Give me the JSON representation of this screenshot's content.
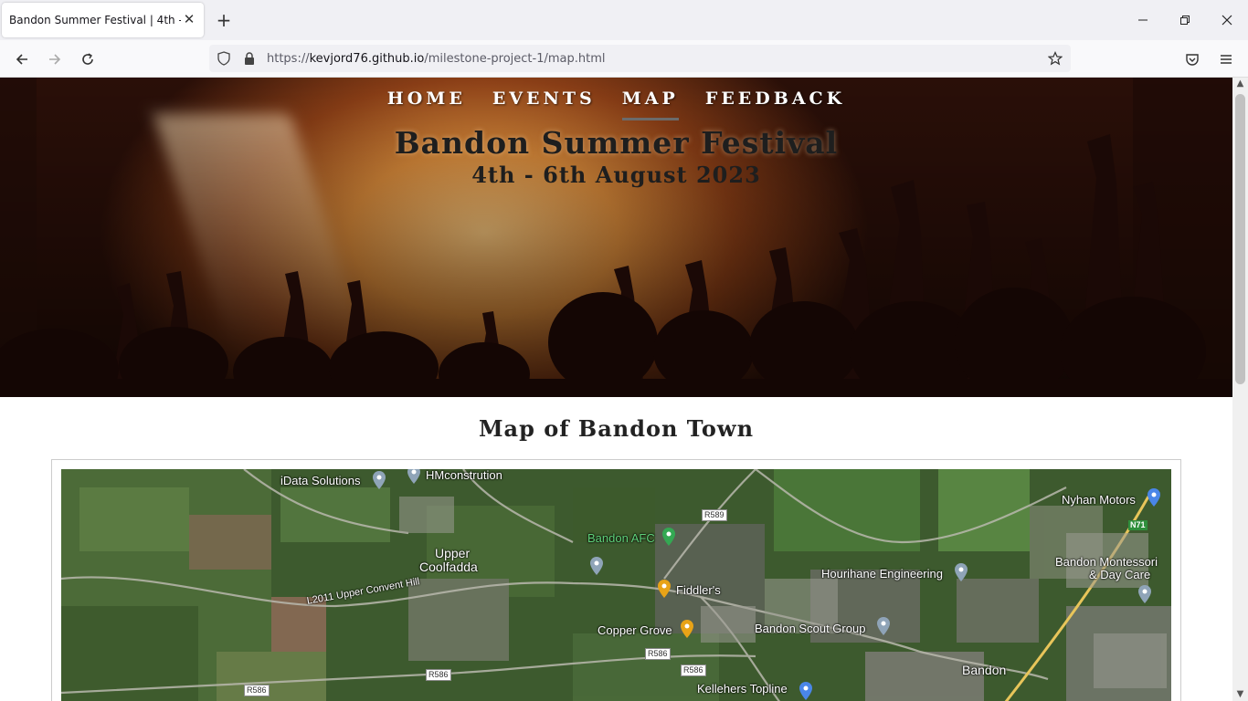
{
  "browser": {
    "tab_title": "Bandon Summer Festival | 4th - 6th August 2023",
    "url_scheme": "https://",
    "url_host": "kevjord76.github.io",
    "url_path": "/milestone-project-1/map.html"
  },
  "nav": {
    "items": [
      {
        "label": "HOME",
        "active": false
      },
      {
        "label": "EVENTS",
        "active": false
      },
      {
        "label": "MAP",
        "active": true
      },
      {
        "label": "FEEDBACK",
        "active": false
      }
    ]
  },
  "hero": {
    "title": "Bandon Summer Festival",
    "subtitle": "4th - 6th August 2023"
  },
  "main": {
    "section_title": "Map of Bandon Town"
  },
  "map": {
    "places": {
      "idata": "iData Solutions",
      "hmconstrution": "HMconstrution",
      "upper": "Upper",
      "coolfadda": "Coolfadda",
      "afc": "Bandon AFC",
      "fiddlers": "Fiddler's",
      "copper_grove": "Copper Grove",
      "hourihane": "Hourihane Engineering",
      "nyhan": "Nyhan Motors",
      "montessori_1": "Bandon Montessori",
      "montessori_2": "& Day Care",
      "scout": "Bandon Scout Group",
      "kellehers": "Kellehers Topline",
      "bandon": "Bandon",
      "convent_hill": "L2011 Upper Convent Hill"
    },
    "roads": {
      "r589": "R589",
      "r586_a": "R586",
      "r586_b": "R586",
      "r586_c": "R586",
      "r586_d": "R586",
      "n71": "N71"
    }
  },
  "colors": {
    "accent_underline": "#6b6b6b",
    "title_text": "#1e1e1e"
  }
}
